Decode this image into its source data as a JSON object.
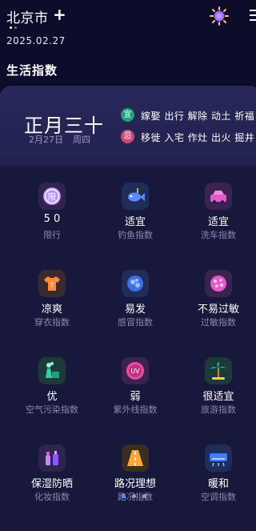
{
  "header": {
    "city": "北京市",
    "date": "2025.02.27"
  },
  "section_title": "生活指数",
  "almanac": {
    "lunar_date": "正月三十",
    "solar_date": "2月27日",
    "weekday": "周四",
    "yi_badge": "宜",
    "ji_badge": "忌",
    "yi_text": "嫁娶 出行 解除 动土 祈福 ...",
    "ji_text": "移徙 入宅 作灶 出火 掘井"
  },
  "indices": [
    {
      "value": "5 0",
      "label": "限行",
      "icon": "restriction-icon"
    },
    {
      "value": "适宜",
      "label": "钓鱼指数",
      "icon": "fish-icon"
    },
    {
      "value": "适宜",
      "label": "洗车指数",
      "icon": "car-wash-icon"
    },
    {
      "value": "凉爽",
      "label": "穿衣指数",
      "icon": "shirt-icon"
    },
    {
      "value": "易发",
      "label": "感冒指数",
      "icon": "cold-icon"
    },
    {
      "value": "不易过敏",
      "label": "过敏指数",
      "icon": "allergy-icon"
    },
    {
      "value": "优",
      "label": "空气污染指数",
      "icon": "factory-icon"
    },
    {
      "value": "弱",
      "label": "紫外线指数",
      "icon": "uv-icon"
    },
    {
      "value": "很适宜",
      "label": "旅游指数",
      "icon": "palm-tree-icon"
    },
    {
      "value": "保湿防晒",
      "label": "化妆指数",
      "icon": "cosmetics-icon"
    },
    {
      "value": "路况理想",
      "label": "路况指数",
      "icon": "road-icon"
    },
    {
      "value": "暖和",
      "label": "空调指数",
      "icon": "air-conditioner-icon"
    }
  ],
  "icons": {
    "weather": "weather-sun-icon",
    "menu": "menu-icon",
    "add": "add-icon"
  },
  "colors": {
    "background": "#0d0d2b",
    "yi": "#1fa07c",
    "ji": "#c8497a",
    "pager_active": "#5b8cff"
  },
  "pager": {
    "pages": 3,
    "active": 1
  }
}
